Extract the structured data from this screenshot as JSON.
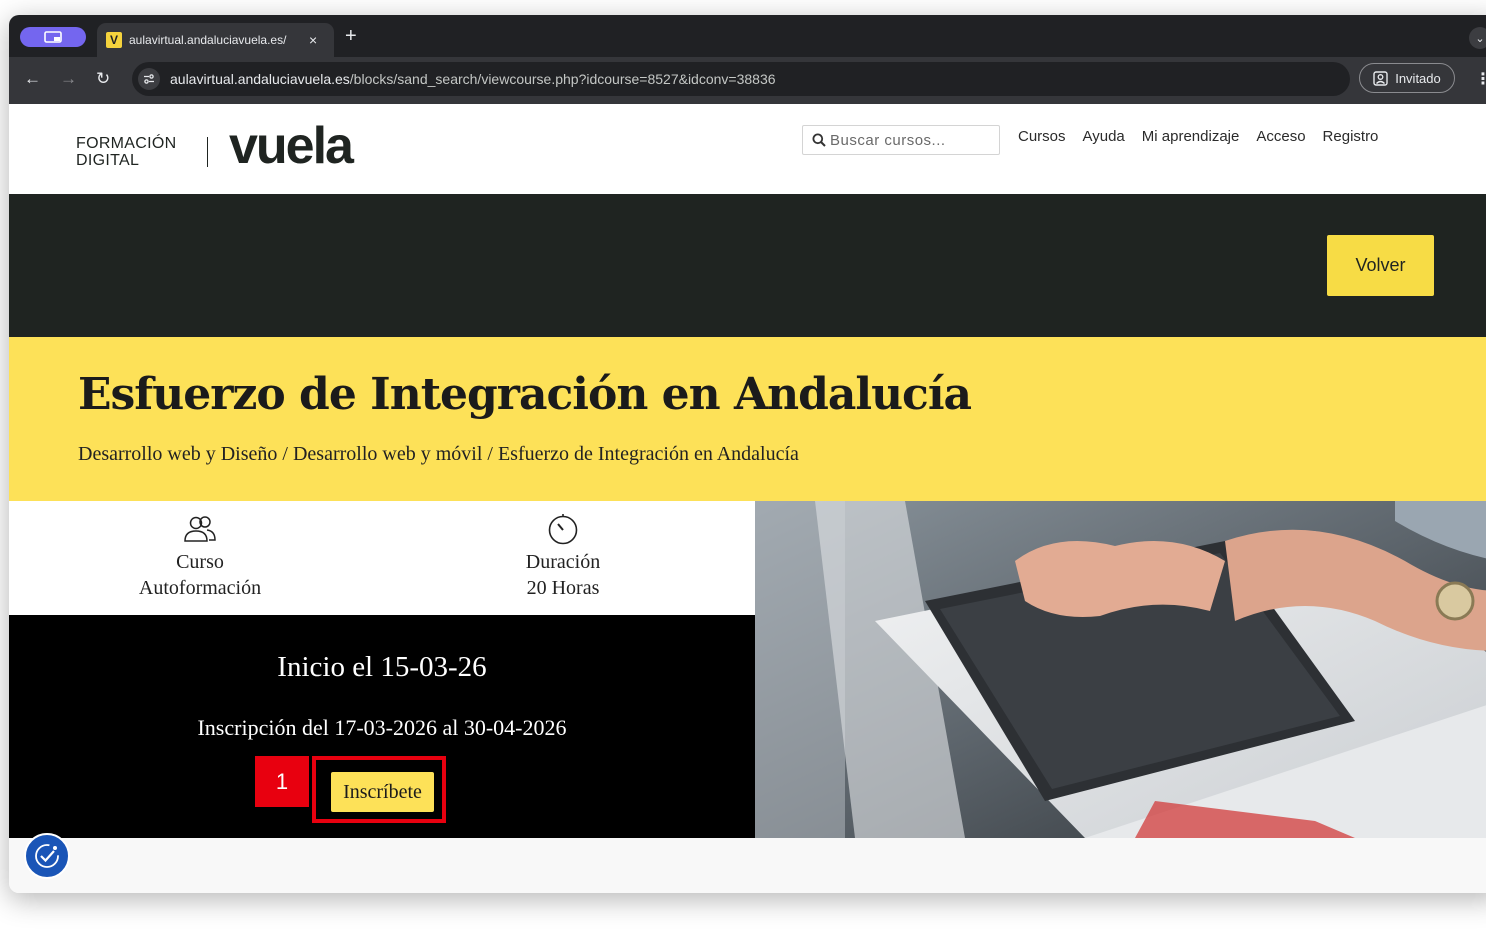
{
  "browser": {
    "tab": {
      "favicon_letter": "V",
      "title": "aulavirtual.andaluciavuela.es/",
      "close": "×"
    },
    "new_tab": "+",
    "url": {
      "host": "aulavirtual.andaluciavuela.es",
      "path": "/blocks/sand_search/viewcourse.php?idcourse=8527&idconv=38836"
    },
    "profile_label": "Invitado",
    "nav": {
      "back": "←",
      "forward": "→",
      "reload": "↻"
    },
    "menu": "⋮",
    "tab_search": "⌄"
  },
  "site": {
    "brand": {
      "line1": "FORMACIÓN",
      "line2": "DIGITAL",
      "logo": "vuela"
    },
    "search": {
      "placeholder": "Buscar cursos..."
    },
    "nav": [
      "Cursos",
      "Ayuda",
      "Mi aprendizaje",
      "Acceso",
      "Registro"
    ],
    "back_button": "Volver"
  },
  "course": {
    "title": "Esfuerzo de Integración en Andalucía",
    "breadcrumb": [
      "Desarrollo web y Diseño",
      "Desarrollo web y móvil",
      "Esfuerzo de Integración en Andalucía"
    ],
    "breadcrumb_sep": "/",
    "info": [
      {
        "icon": "users-icon",
        "line1": "Curso",
        "line2": "Autoformación"
      },
      {
        "icon": "timer-icon",
        "line1": "Duración",
        "line2": "20 Horas"
      }
    ],
    "start": "Inicio el 15-03-26",
    "enrollment": "Inscripción del 17-03-2026 al 30-04-2026",
    "enroll_button": "Inscríbete"
  },
  "annotation": {
    "step_number": "1",
    "color": "#e8000f"
  },
  "colors": {
    "brand_yellow": "#fde158",
    "dark_band": "#1f2421",
    "accessibility_blue": "#1a55b7"
  }
}
